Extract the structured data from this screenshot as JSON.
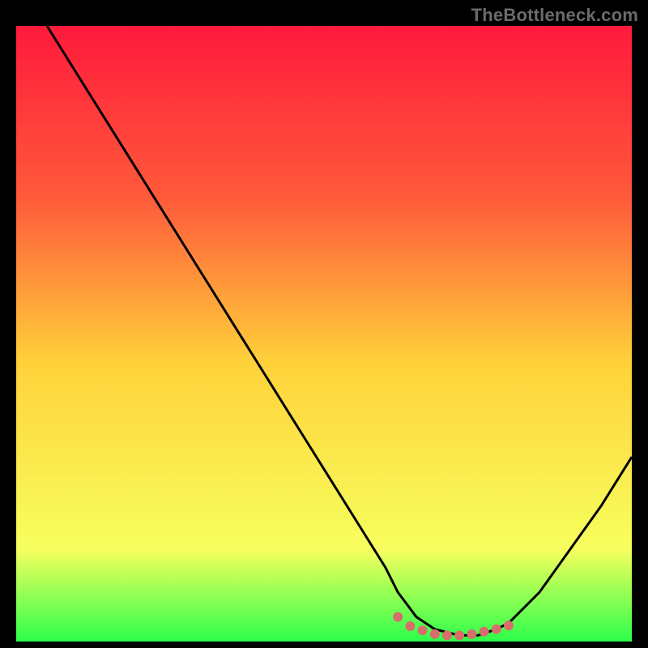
{
  "watermark": "TheBottleneck.com",
  "colors": {
    "grad_top": "#ff1a3c",
    "grad_upper": "#ff5a3a",
    "grad_mid": "#ffd23a",
    "grad_low": "#f7ff5e",
    "grad_bottom": "#2cff4a",
    "curve": "#000000",
    "marker": "#d86d6d",
    "frame": "#000000"
  },
  "chart_data": {
    "type": "line",
    "title": "",
    "xlabel": "",
    "ylabel": "",
    "xlim": [
      0,
      100
    ],
    "ylim": [
      0,
      100
    ],
    "series": [
      {
        "name": "bottleneck-curve",
        "x": [
          5,
          10,
          15,
          20,
          25,
          30,
          35,
          40,
          45,
          50,
          55,
          60,
          62,
          65,
          68,
          72,
          75,
          78,
          80,
          85,
          90,
          95,
          100
        ],
        "y": [
          100,
          92,
          84,
          76,
          68,
          60,
          52,
          44,
          36,
          28,
          20,
          12,
          8,
          4,
          2,
          1,
          1,
          2,
          3,
          8,
          15,
          22,
          30
        ]
      }
    ],
    "annotations": [
      {
        "name": "valley-markers",
        "shape": "dot-cluster",
        "x": [
          62,
          64,
          66,
          68,
          70,
          72,
          74,
          76,
          78,
          80
        ],
        "y": [
          4,
          2.5,
          1.8,
          1.2,
          1,
          1,
          1.2,
          1.6,
          2,
          2.6
        ]
      }
    ]
  }
}
